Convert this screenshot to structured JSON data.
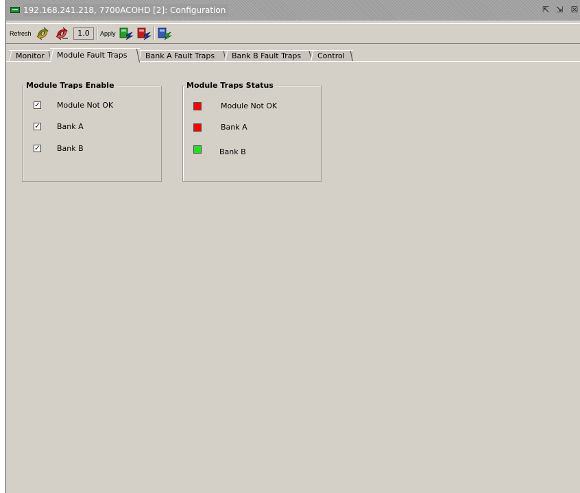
{
  "window": {
    "title": "192.168.241.218, 7700ACOHD  [2]: Configuration",
    "icon": "network-card-icon",
    "buttons": [
      "restore-icon",
      "maximize-icon",
      "close-icon"
    ]
  },
  "toolbar": {
    "refresh_label": "Refresh",
    "value": "1.0",
    "apply_label": "Apply",
    "icons": [
      "refresh-icon",
      "auto-refresh-icon",
      "apply-green-icon",
      "apply-red-icon",
      "apply-blue-icon"
    ]
  },
  "tabs": [
    {
      "label": "Monitor",
      "active": false
    },
    {
      "label": "Module Fault Traps",
      "active": true
    },
    {
      "label": "Bank A Fault Traps",
      "active": false
    },
    {
      "label": "Bank B Fault Traps",
      "active": false
    },
    {
      "label": "Control",
      "active": false
    }
  ],
  "enable_group": {
    "title": "Module Traps Enable",
    "items": [
      {
        "label": "Module Not OK",
        "checked": true
      },
      {
        "label": "Bank A",
        "checked": true
      },
      {
        "label": "Bank B",
        "checked": true
      }
    ]
  },
  "status_group": {
    "title": "Module Traps Status",
    "items": [
      {
        "label": "Module Not OK",
        "status": "fault",
        "color": "#ff0000"
      },
      {
        "label": "Bank A",
        "status": "fault",
        "color": "#ff0000"
      },
      {
        "label": "Bank B",
        "status": "ok",
        "color": "#22dd22"
      }
    ]
  }
}
